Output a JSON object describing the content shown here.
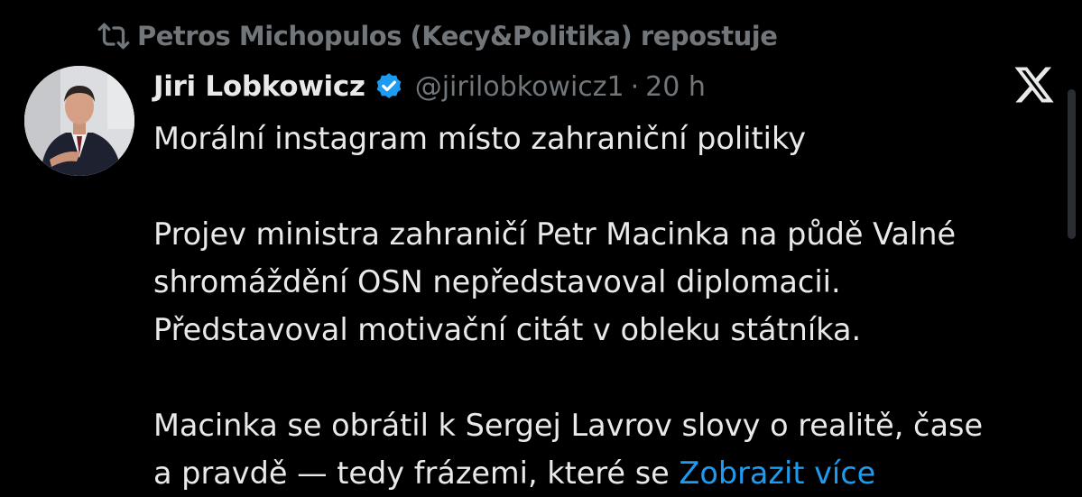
{
  "repost": {
    "icon": "repost-icon",
    "text": "Petros Michopulos (Kecy&Politika) repostuje"
  },
  "author": {
    "name": "Jiri Lobkowicz",
    "verified_icon": "verified-badge-icon",
    "handle": "@jirilobkowicz1",
    "separator": "·",
    "time": "20 h"
  },
  "platform": {
    "logo": "x-logo-icon"
  },
  "tweet": {
    "line1": "Morální instagram místo zahraniční politiky",
    "para2_line1": "Projev ministra zahraničí Petr Macinka na půdě Valné",
    "para2_line2": "shromáždění OSN nepředstavoval diplomacii.",
    "para2_line3": "Představoval motivační citát v obleku státníka.",
    "para3_line1": "Macinka se obrátil k Sergej Lavrov slovy o realitě, čase",
    "para3_line2": "a pravdě — tedy frázemi, které se",
    "show_more": "Zobrazit více"
  },
  "colors": {
    "background": "#000000",
    "text": "#e7e9ea",
    "muted": "#71767b",
    "link": "#1d9bf0",
    "verified": "#1d9bf0"
  }
}
